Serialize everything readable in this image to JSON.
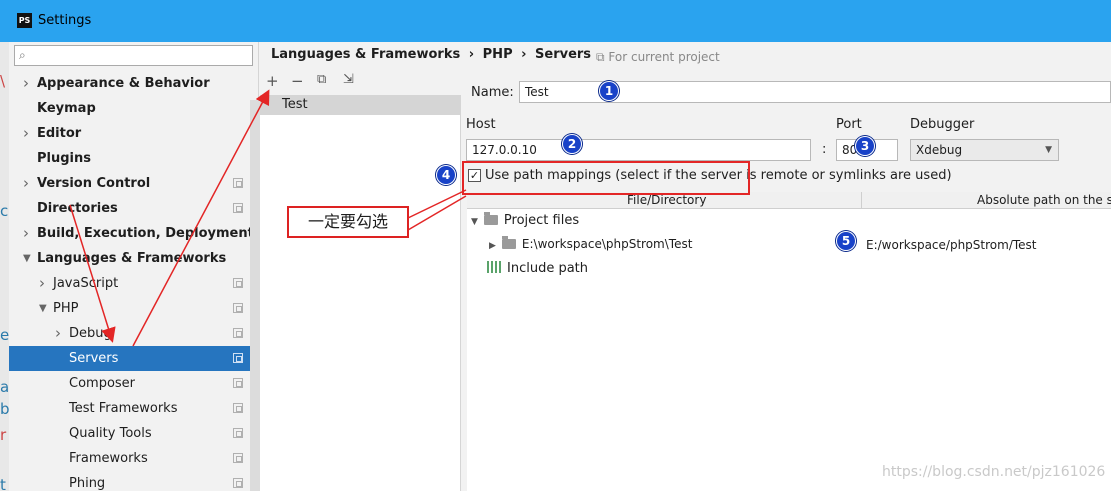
{
  "window": {
    "title": "Settings",
    "app_icon": "PS"
  },
  "left_edge_chars": [
    "\\",
    "c",
    "e",
    "a",
    "b",
    "r",
    "t"
  ],
  "search": {
    "placeholder": "",
    "icon": "search-icon"
  },
  "tree": [
    {
      "label": "Appearance & Behavior",
      "bold": true,
      "arrow": "right"
    },
    {
      "label": "Keymap",
      "bold": true,
      "arrow": ""
    },
    {
      "label": "Editor",
      "bold": true,
      "arrow": "right"
    },
    {
      "label": "Plugins",
      "bold": true,
      "arrow": ""
    },
    {
      "label": "Version Control",
      "bold": true,
      "arrow": "right",
      "project": true
    },
    {
      "label": "Directories",
      "bold": true,
      "arrow": "",
      "project": true
    },
    {
      "label": "Build, Execution, Deployment",
      "bold": true,
      "arrow": "right"
    },
    {
      "label": "Languages & Frameworks",
      "bold": true,
      "arrow": "down"
    },
    {
      "label": "JavaScript",
      "bold": false,
      "arrow": "right",
      "project": true
    },
    {
      "label": "PHP",
      "bold": false,
      "arrow": "down",
      "project": true
    },
    {
      "label": "Debug",
      "bold": false,
      "arrow": "right",
      "project": true
    },
    {
      "label": "Servers",
      "bold": false,
      "arrow": "",
      "project": true,
      "selected": true
    },
    {
      "label": "Composer",
      "bold": false,
      "arrow": "",
      "project": true
    },
    {
      "label": "Test Frameworks",
      "bold": false,
      "arrow": "",
      "project": true
    },
    {
      "label": "Quality Tools",
      "bold": false,
      "arrow": "",
      "project": true
    },
    {
      "label": "Frameworks",
      "bold": false,
      "arrow": "",
      "project": true
    },
    {
      "label": "Phing",
      "bold": false,
      "arrow": "",
      "project": true
    }
  ],
  "breadcrumb": {
    "part1": "Languages & Frameworks",
    "sep": "›",
    "part2": "PHP",
    "part3": "Servers"
  },
  "scope": "For current project",
  "toolbar": {
    "add": "+",
    "remove": "−",
    "copy": "⧉",
    "import": "⇲"
  },
  "servers": [
    "Test"
  ],
  "form": {
    "name_label": "Name:",
    "name_value": "Test",
    "host_label": "Host",
    "host_value": "127.0.0.10",
    "port_label": "Port",
    "port_sep": ":",
    "port_value": "80",
    "debugger_label": "Debugger",
    "debugger_value": "Xdebug",
    "use_mappings_label": "Use path mappings (select if the server is remote or symlinks are used)",
    "use_mappings_checked": true
  },
  "mappings": {
    "col1": "File/Directory",
    "col2": "Absolute path on the server",
    "project_files": "Project files",
    "local_path": "E:\\workspace\\phpStrom\\Test",
    "remote_path": "E:/workspace/phpStrom/Test",
    "include_path": "Include path"
  },
  "annotations": {
    "badges": [
      "1",
      "2",
      "3",
      "4",
      "5"
    ],
    "callout": "一定要勾选",
    "color": "#e32626"
  },
  "watermark": "https://blog.csdn.net/pjz161026"
}
